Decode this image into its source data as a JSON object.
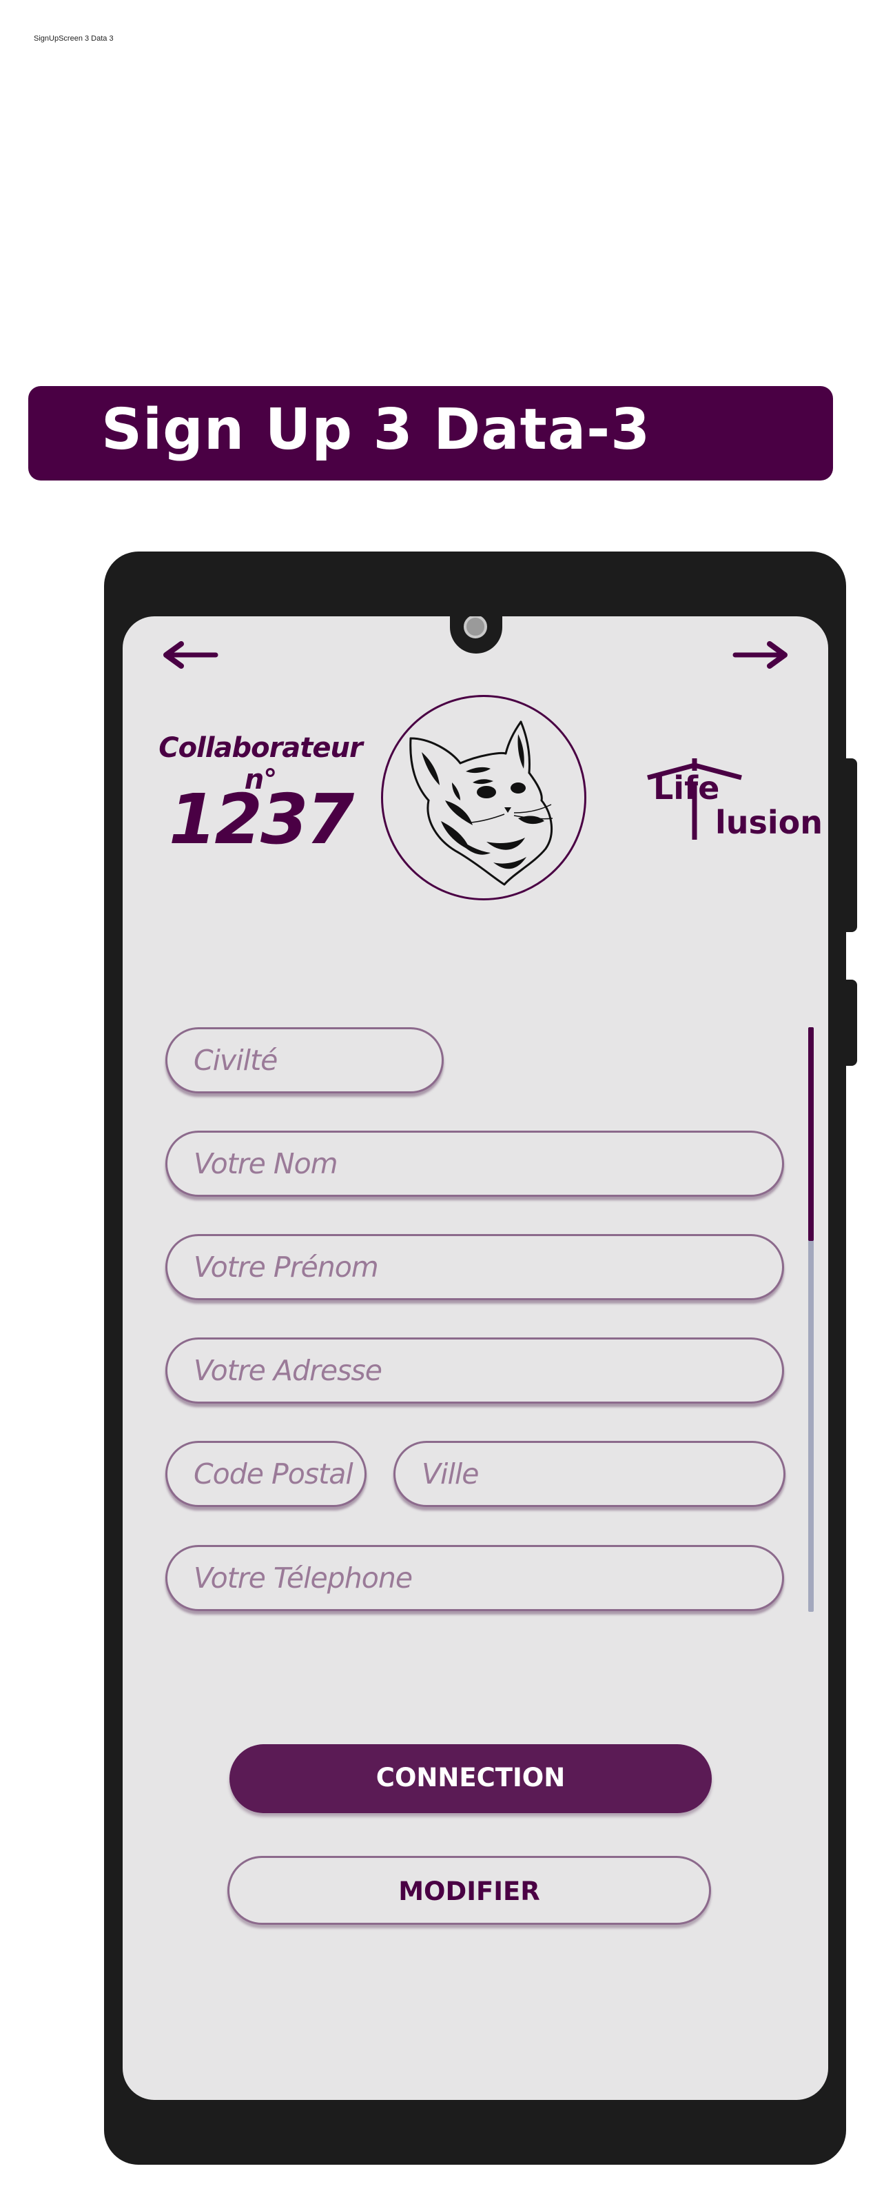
{
  "frame_label": "SignUpScreen 3 Data 3",
  "banner": {
    "title": "Sign Up 3 Data-3"
  },
  "header": {
    "collaborator_label": "Collaborateur n°",
    "collaborator_number": "1237",
    "logo_line1": "Life",
    "logo_line2": "lusion",
    "back_icon": "arrow-left-icon",
    "forward_icon": "arrow-right-icon",
    "avatar_icon": "cat-head-illustration"
  },
  "form": {
    "civilite": {
      "placeholder": "Civilté",
      "value": ""
    },
    "nom": {
      "placeholder": "Votre Nom",
      "value": ""
    },
    "prenom": {
      "placeholder": "Votre Prénom",
      "value": ""
    },
    "adresse": {
      "placeholder": "Votre Adresse",
      "value": ""
    },
    "code_postal": {
      "placeholder": "Code Postal",
      "value": ""
    },
    "ville": {
      "placeholder": "Ville",
      "value": ""
    },
    "telephone": {
      "placeholder": "Votre Télephone",
      "value": ""
    }
  },
  "actions": {
    "connection_label": "CONNECTION",
    "modifier_label": "MODIFIER"
  },
  "colors": {
    "brand": "#4a0044",
    "primary_button": "#5b1b55",
    "field_border": "#8c6a8c",
    "placeholder": "#9a7a98",
    "screen_bg": "#e6e5e6",
    "phone_body": "#1c1c1c",
    "scroll_track": "#a3a8bd"
  }
}
